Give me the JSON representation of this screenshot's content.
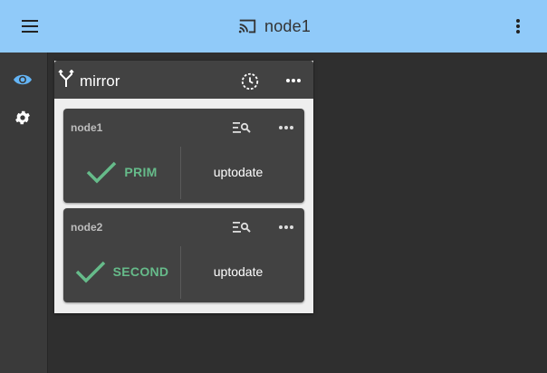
{
  "app": {
    "title": "node1"
  },
  "colors": {
    "topbar": "#90caf9",
    "active_icon": "#64b5f6",
    "success": "#66bb8a"
  },
  "sidebar": {
    "items": [
      {
        "icon": "eye-icon",
        "active": true
      },
      {
        "icon": "gear-icon",
        "active": false
      }
    ]
  },
  "panel": {
    "title": "mirror",
    "icon": "fork-icon",
    "nodes": [
      {
        "name": "node1",
        "role": "PRIM",
        "status": "uptodate"
      },
      {
        "name": "node2",
        "role": "SECOND",
        "status": "uptodate"
      }
    ]
  }
}
